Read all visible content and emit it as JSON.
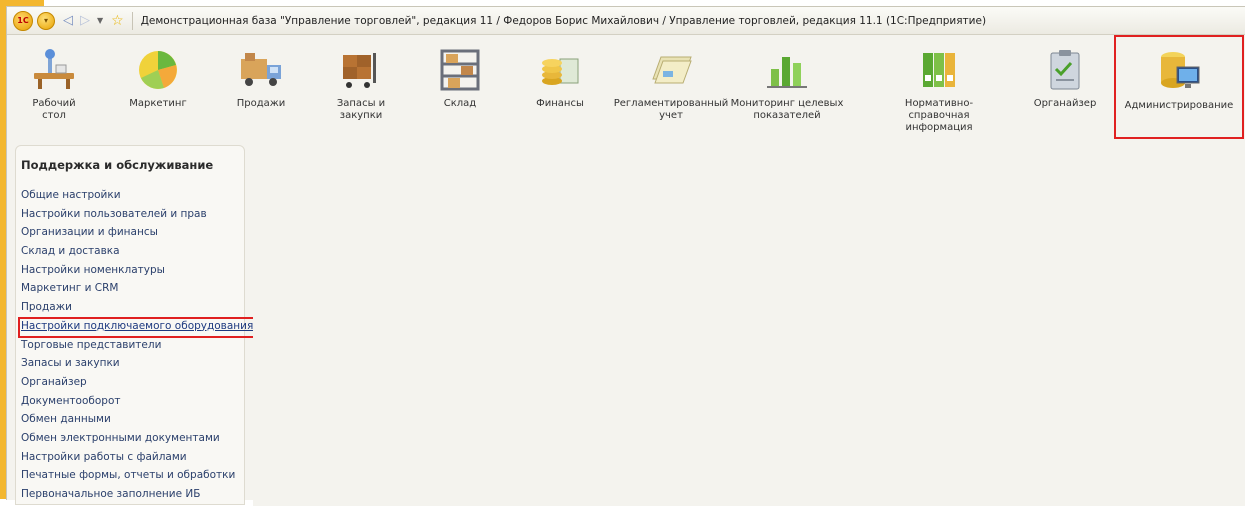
{
  "window": {
    "title": "Демонстрационная база \"Управление торговлей\", редакция 11 / Федоров Борис Михайлович / Управление торговлей, редакция 11.1  (1С:Предприятие)",
    "logo_text": "1С"
  },
  "sections": [
    {
      "label": "Рабочий\nстол",
      "icon": "desk-icon"
    },
    {
      "label": "Маркетинг",
      "icon": "pie-chart-icon"
    },
    {
      "label": "Продажи",
      "icon": "truck-icon"
    },
    {
      "label": "Запасы и\nзакупки",
      "icon": "boxes-cart-icon"
    },
    {
      "label": "Склад",
      "icon": "shelves-icon"
    },
    {
      "label": "Финансы",
      "icon": "coins-icon"
    },
    {
      "label": "Регламентированный\nучет",
      "icon": "documents-icon"
    },
    {
      "label": "Мониторинг целевых\nпоказателей",
      "icon": "bar-chart-icon"
    },
    {
      "label": "Нормативно-справочная\nинформация",
      "icon": "binders-icon"
    },
    {
      "label": "Органайзер",
      "icon": "clipboard-icon"
    },
    {
      "label": "Администрирование",
      "icon": "database-monitor-icon",
      "active": true
    }
  ],
  "panel": {
    "title": "Поддержка и обслуживание",
    "items": [
      "Общие настройки",
      "Настройки пользователей и прав",
      "Организации и финансы",
      "Склад и доставка",
      "Настройки номенклатуры",
      "Маркетинг и CRM",
      "Продажи",
      "Настройки подключаемого оборудования",
      "Торговые представители",
      "Запасы и закупки",
      "Органайзер",
      "Документооборот",
      "Обмен данными",
      "Обмен электронными документами",
      "Настройки работы с файлами",
      "Печатные формы, отчеты и обработки",
      "Первоначальное заполнение ИБ"
    ],
    "highlighted_item": "Настройки подключаемого оборудования"
  },
  "colors": {
    "accent_bar": "#f3b72f",
    "highlight_border": "#e02020",
    "link": "#2a3f6b"
  }
}
